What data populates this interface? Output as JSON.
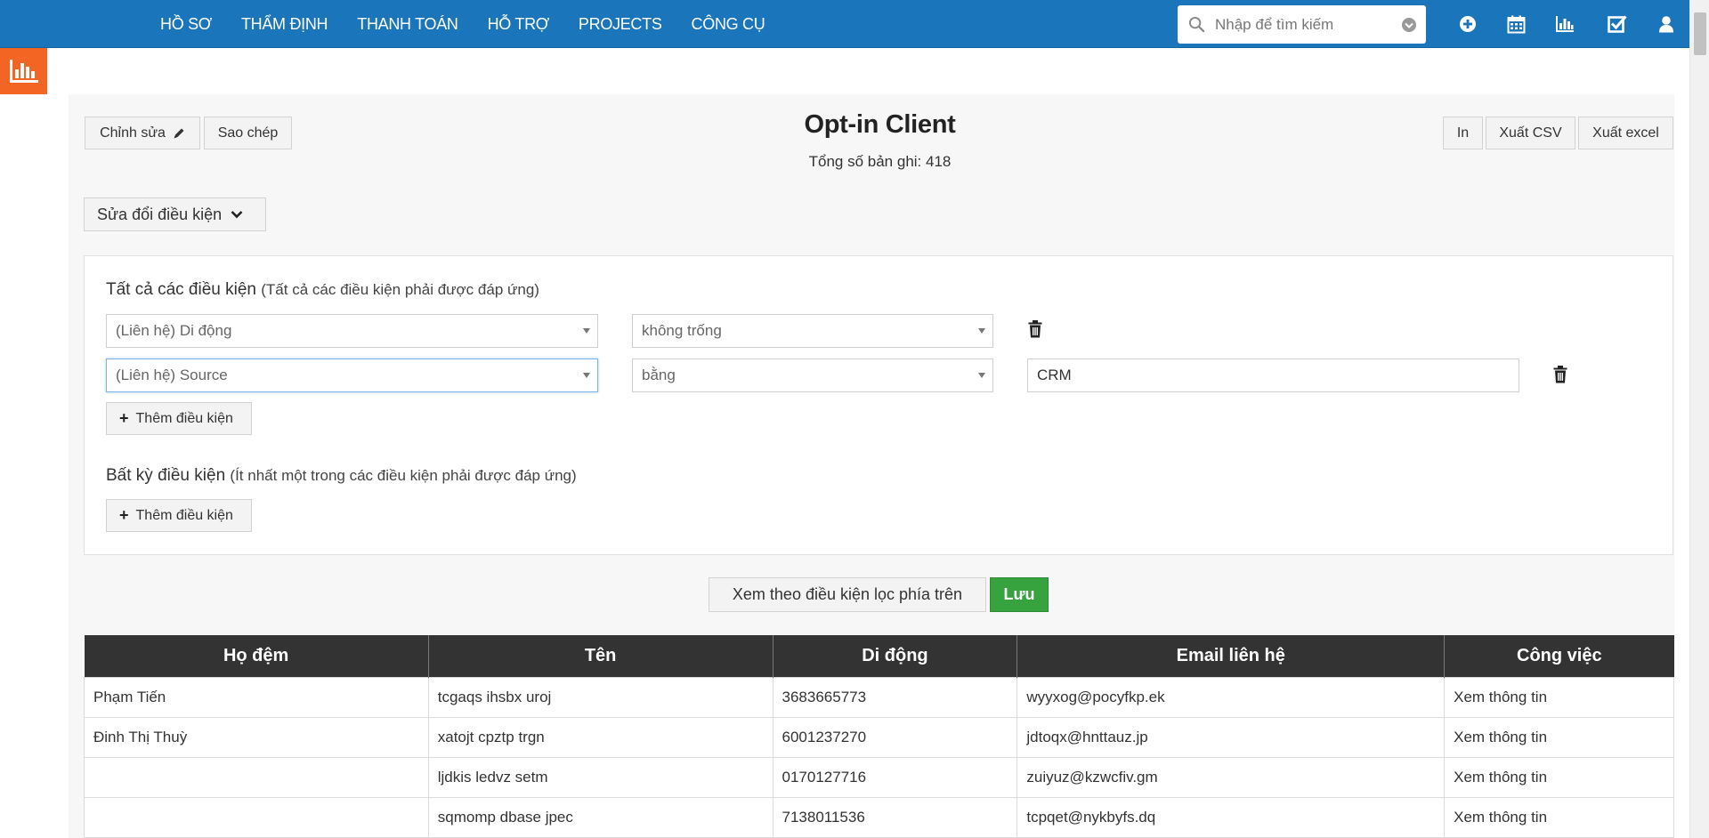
{
  "nav": {
    "items": [
      {
        "label": "HỒ SƠ"
      },
      {
        "label": "THẨM ĐỊNH"
      },
      {
        "label": "THANH TOÁN"
      },
      {
        "label": "HỖ TRỢ"
      },
      {
        "label": "PROJECTS"
      },
      {
        "label": "CÔNG CỤ"
      }
    ],
    "search_placeholder": "Nhập để tìm kiếm",
    "icons": [
      "plus-circle-icon",
      "calendar-icon",
      "bar-chart-icon",
      "checkbox-icon",
      "user-icon"
    ]
  },
  "sidebar": {
    "icon": "report-chart-icon"
  },
  "toolbar": {
    "edit_label": "Chỉnh sửa",
    "copy_label": "Sao chép",
    "print_label": "In",
    "csv_label": "Xuất CSV",
    "excel_label": "Xuất excel"
  },
  "report": {
    "title": "Opt-in Client",
    "total": "Tổng số bản ghi: 418"
  },
  "filter": {
    "toggle_label": "Sửa đổi điều kiện",
    "all": {
      "title": "Tất cả các điều kiện",
      "hint": "(Tất cả các điều kiện phải được đáp ứng)",
      "rows": [
        {
          "field": "(Liên hệ) Di động",
          "operator": "không trống",
          "value": ""
        },
        {
          "field": "(Liên hệ) Source",
          "operator": "bằng",
          "value": "CRM"
        }
      ],
      "add_label": "Thêm điều kiện"
    },
    "any": {
      "title": "Bất kỳ điều kiện",
      "hint": "(Ít nhất một trong các điều kiện phải được đáp ứng)",
      "add_label": "Thêm điều kiện"
    },
    "view_label": "Xem theo điều kiện lọc phía trên",
    "save_label": "Lưu"
  },
  "table": {
    "columns": [
      "Họ đệm",
      "Tên",
      "Di động",
      "Email liên hệ",
      "Công việc"
    ],
    "rows": [
      [
        "Phạm Tiến",
        "tcgaqs ihsbx uroj",
        "3683665773",
        "wyyxog@pocyfkp.ek",
        "Xem thông tin"
      ],
      [
        "Đinh Thị Thuỳ",
        "xatojt cpztp trgn",
        "6001237270",
        "jdtoqx@hnttauz.jp",
        "Xem thông tin"
      ],
      [
        "",
        "ljdkis ledvz setm",
        "0170127716",
        "zuiyuz@kzwcfiv.gm",
        "Xem thông tin"
      ],
      [
        "",
        "sqmomp dbase jpec",
        "7138011536",
        "tcpqet@nykbyfs.dq",
        "Xem thông tin"
      ]
    ]
  },
  "colors": {
    "topbar": "#1a75bb",
    "sidetab": "#f26522",
    "save": "#37a33f",
    "table_header": "#333333"
  }
}
